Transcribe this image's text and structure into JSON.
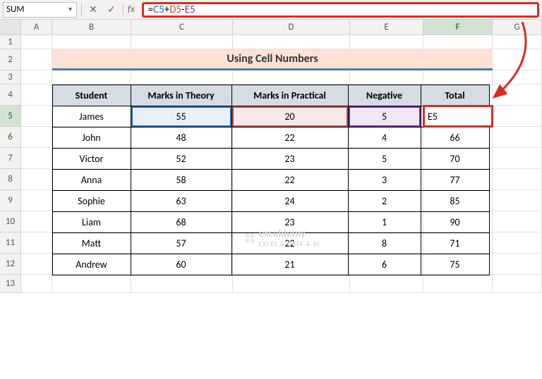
{
  "name_box": "SUM",
  "formula": {
    "raw": "=C5+D5-E5",
    "parts": {
      "c": "C5",
      "d": "D5",
      "e": "E5"
    }
  },
  "columns": [
    "A",
    "B",
    "C",
    "D",
    "E",
    "F",
    "G"
  ],
  "rows": [
    "1",
    "2",
    "3",
    "4",
    "5",
    "6",
    "7",
    "8",
    "9",
    "10",
    "11",
    "12",
    "13"
  ],
  "title": "Using Cell Numbers",
  "headers": {
    "student": "Student",
    "theory": "Marks in Theory",
    "practical": "Marks in Practical",
    "negative": "Negative",
    "total": "Total"
  },
  "editing_cell_display": "E5",
  "data": [
    {
      "student": "James",
      "theory": "55",
      "practical": "20",
      "negative": "5",
      "total": ""
    },
    {
      "student": "John",
      "theory": "48",
      "practical": "22",
      "negative": "4",
      "total": "66"
    },
    {
      "student": "Victor",
      "theory": "52",
      "practical": "23",
      "negative": "5",
      "total": "70"
    },
    {
      "student": "Anna",
      "theory": "58",
      "practical": "22",
      "negative": "3",
      "total": "77"
    },
    {
      "student": "Sophie",
      "theory": "63",
      "practical": "24",
      "negative": "2",
      "total": "85"
    },
    {
      "student": "Liam",
      "theory": "68",
      "practical": "23",
      "negative": "1",
      "total": "90"
    },
    {
      "student": "Matt",
      "theory": "57",
      "practical": "22",
      "negative": "8",
      "total": "71"
    },
    {
      "student": "Andrew",
      "theory": "60",
      "practical": "21",
      "negative": "6",
      "total": "75"
    }
  ],
  "watermark": {
    "brand": "exceldemy",
    "tag": "EXCEL & DATA & BI"
  }
}
